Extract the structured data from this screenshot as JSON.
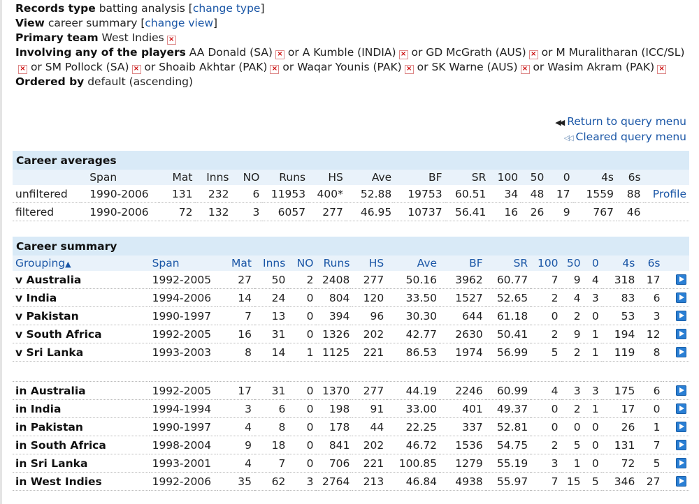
{
  "filters": {
    "records_type": {
      "label": "Records type",
      "value": "batting analysis",
      "link": "change type"
    },
    "view": {
      "label": "View",
      "value": "career summary",
      "link": "change view"
    },
    "primary_team": {
      "label": "Primary team",
      "value": "West Indies"
    },
    "players": {
      "label": "Involving any of the players",
      "separator": "or",
      "items": [
        "AA Donald (SA)",
        "A Kumble (INDIA)",
        "GD McGrath (AUS)",
        "M Muralitharan (ICC/SL)",
        "SM Pollock (SA)",
        "Shoaib Akhtar (PAK)",
        "Waqar Younis (PAK)",
        "SK Warne (AUS)",
        "Wasim Akram (PAK)"
      ]
    },
    "ordered_by": {
      "label": "Ordered by",
      "value": "default (ascending)"
    }
  },
  "query_links": {
    "return": "Return to query menu",
    "cleared": "Cleared query menu"
  },
  "career_averages": {
    "title": "Career averages",
    "columns": [
      "",
      "Span",
      "Mat",
      "Inns",
      "NO",
      "Runs",
      "HS",
      "Ave",
      "BF",
      "SR",
      "100",
      "50",
      "0",
      "4s",
      "6s",
      ""
    ],
    "rows": [
      [
        "unfiltered",
        "1990-2006",
        "131",
        "232",
        "6",
        "11953",
        "400*",
        "52.88",
        "19753",
        "60.51",
        "34",
        "48",
        "17",
        "1559",
        "88",
        "Profile"
      ],
      [
        "filtered",
        "1990-2006",
        "72",
        "132",
        "3",
        "6057",
        "277",
        "46.95",
        "10737",
        "56.41",
        "16",
        "26",
        "9",
        "767",
        "46",
        ""
      ]
    ]
  },
  "career_summary": {
    "title": "Career summary",
    "columns": [
      "Grouping",
      "Span",
      "Mat",
      "Inns",
      "NO",
      "Runs",
      "HS",
      "Ave",
      "BF",
      "SR",
      "100",
      "50",
      "0",
      "4s",
      "6s"
    ],
    "groups": [
      [
        [
          "v Australia",
          "1992-2005",
          "27",
          "50",
          "2",
          "2408",
          "277",
          "50.16",
          "3962",
          "60.77",
          "7",
          "9",
          "4",
          "318",
          "17"
        ],
        [
          "v India",
          "1994-2006",
          "14",
          "24",
          "0",
          "804",
          "120",
          "33.50",
          "1527",
          "52.65",
          "2",
          "4",
          "3",
          "83",
          "6"
        ],
        [
          "v Pakistan",
          "1990-1997",
          "7",
          "13",
          "0",
          "394",
          "96",
          "30.30",
          "644",
          "61.18",
          "0",
          "2",
          "0",
          "53",
          "3"
        ],
        [
          "v South Africa",
          "1992-2005",
          "16",
          "31",
          "0",
          "1326",
          "202",
          "42.77",
          "2630",
          "50.41",
          "2",
          "9",
          "1",
          "194",
          "12"
        ],
        [
          "v Sri Lanka",
          "1993-2003",
          "8",
          "14",
          "1",
          "1125",
          "221",
          "86.53",
          "1974",
          "56.99",
          "5",
          "2",
          "1",
          "119",
          "8"
        ]
      ],
      [
        [
          "in Australia",
          "1992-2005",
          "17",
          "31",
          "0",
          "1370",
          "277",
          "44.19",
          "2246",
          "60.99",
          "4",
          "3",
          "3",
          "175",
          "6"
        ],
        [
          "in India",
          "1994-1994",
          "3",
          "6",
          "0",
          "198",
          "91",
          "33.00",
          "401",
          "49.37",
          "0",
          "2",
          "1",
          "17",
          "0"
        ],
        [
          "in Pakistan",
          "1990-1997",
          "4",
          "8",
          "0",
          "178",
          "44",
          "22.25",
          "337",
          "52.81",
          "0",
          "0",
          "0",
          "26",
          "1"
        ],
        [
          "in South Africa",
          "1998-2004",
          "9",
          "18",
          "0",
          "841",
          "202",
          "46.72",
          "1536",
          "54.75",
          "2",
          "5",
          "0",
          "131",
          "7"
        ],
        [
          "in Sri Lanka",
          "1993-2001",
          "4",
          "7",
          "0",
          "706",
          "221",
          "100.85",
          "1279",
          "55.19",
          "3",
          "1",
          "0",
          "72",
          "5"
        ],
        [
          "in West Indies",
          "1992-2006",
          "35",
          "62",
          "3",
          "2764",
          "213",
          "46.84",
          "4938",
          "55.97",
          "7",
          "15",
          "5",
          "346",
          "27"
        ]
      ]
    ]
  }
}
